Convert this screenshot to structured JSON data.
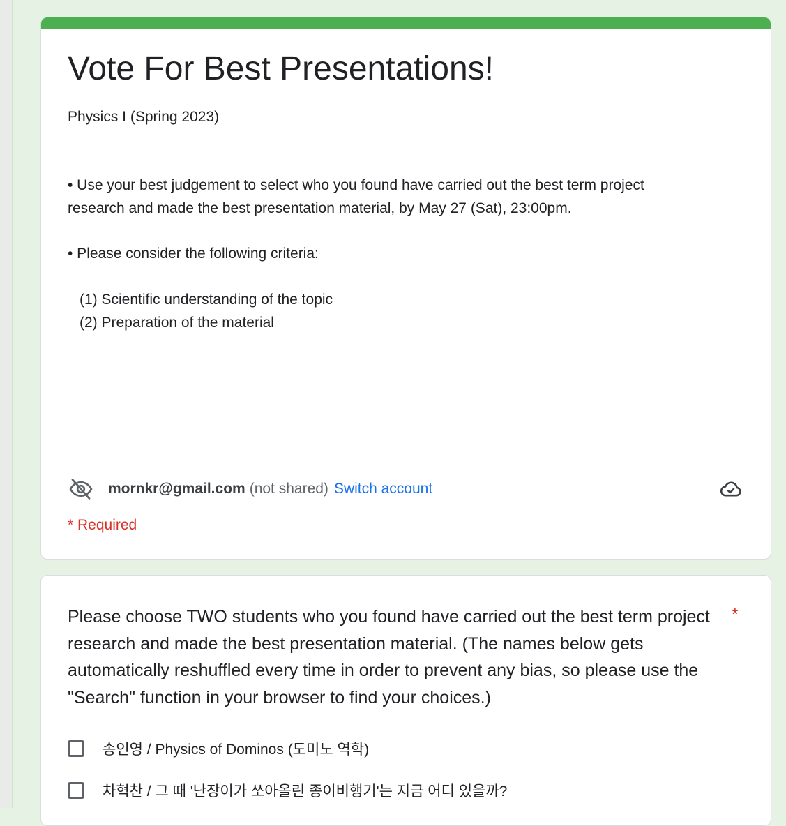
{
  "form": {
    "title": "Vote For Best Presentations!",
    "subtitle": "Physics I (Spring 2023)",
    "description": [
      "• Use your best judgement to select who you found have carried out the best term project",
      "research and made the best presentation material, by May 27 (Sat), 23:00pm.",
      "• Please consider the following criteria:",
      "(1) Scientific understanding of the topic",
      "(2) Preparation of the material"
    ],
    "accent_color": "#4caf50"
  },
  "account": {
    "email": "mornkr@gmail.com",
    "not_shared": "(not shared)",
    "switch_label": "Switch account",
    "required_note": "* Required",
    "icon_left": "eye-off-icon",
    "icon_right": "cloud-check-icon"
  },
  "question": {
    "text": "Please choose TWO students who you found have carried out the best term project research and made the best presentation material.  (The names below gets automatically reshuffled every time in order to prevent any bias, so please use the \"Search\" function in your browser to find your choices.)",
    "required_mark": "*",
    "options": [
      {
        "label": "송인영 / Physics of Dominos (도미노 역학)",
        "checked": false
      },
      {
        "label": "차혁찬 / 그 때 '난장이가 쏘아올린 종이비행기'는 지금 어디 있을까?",
        "checked": false
      }
    ]
  }
}
